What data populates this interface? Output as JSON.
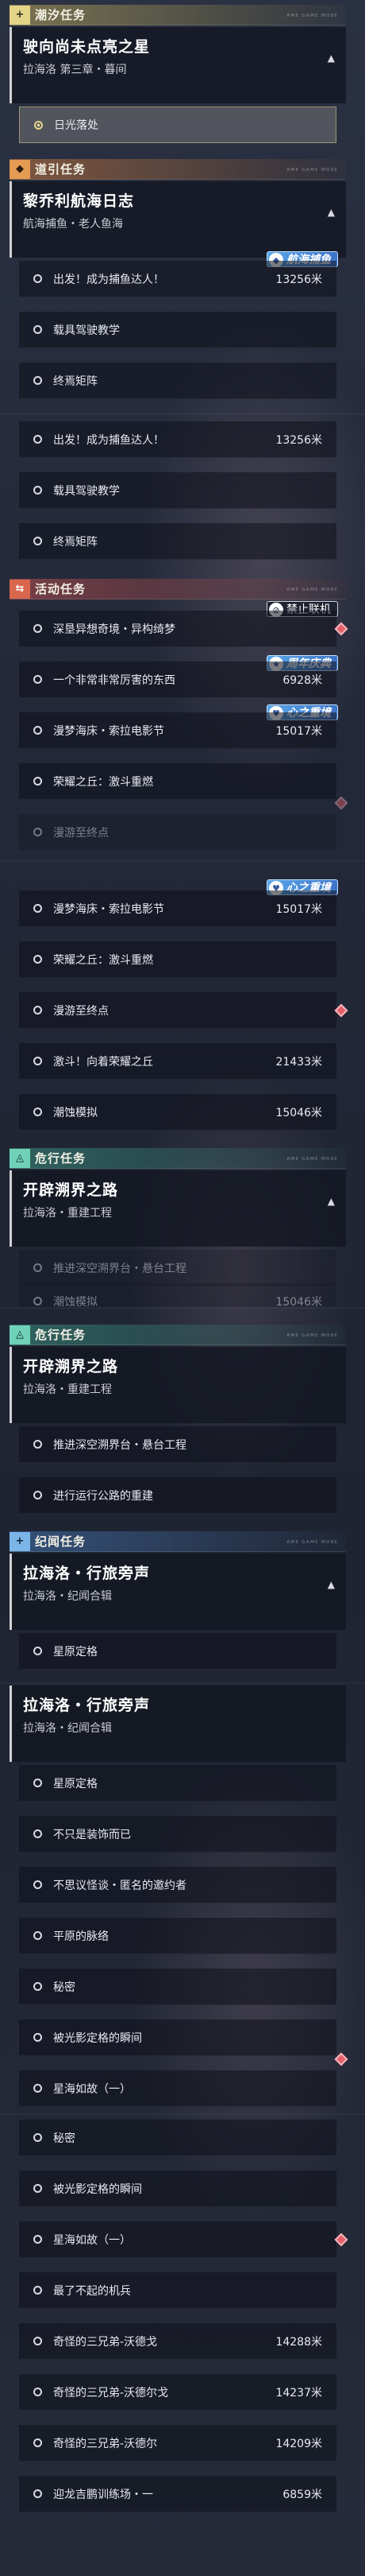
{
  "categories": {
    "tide": {
      "icon": "+",
      "title": "潮汐任务"
    },
    "guide": {
      "icon": "◆",
      "title": "道引任务"
    },
    "event": {
      "icon": "⇆",
      "title": "活动任务"
    },
    "danger": {
      "icon": "◬",
      "title": "危行任务"
    },
    "record": {
      "icon": "+",
      "title": "纪闻任务"
    },
    "deco": "ᴀᴍᴇ ɢᴀᴍᴇ ᴍᴏᴅᴇ"
  },
  "tide_card": {
    "title": "驶向尚未点亮之星",
    "sub": "拉海洛 第三章・暮间",
    "toggle": "▲"
  },
  "tide_item": "日光落处",
  "guide_card": {
    "title": "黎乔利航海日志",
    "sub": "航海捕鱼・老人鱼海",
    "toggle": "▲"
  },
  "guide_items": [
    {
      "label": "出发！成为捕鱼达人！",
      "dist": "13256米"
    },
    {
      "label": "载具驾驶教学",
      "dist": ""
    },
    {
      "label": "终焉矩阵",
      "dist": ""
    }
  ],
  "tags": {
    "fishing": "航海捕鱼",
    "nonet": "禁止联机",
    "anniv": "周年庆典",
    "heart": "心之重境"
  },
  "event_items": [
    {
      "label": "深垦异想奇境・异构绮梦",
      "dist": ""
    },
    {
      "label": "一个非常非常厉害的东西",
      "dist": "6928米"
    },
    {
      "label": "漫梦海床・索拉电影节",
      "dist": "15017米"
    },
    {
      "label": "荣耀之丘：激斗重燃",
      "dist": ""
    },
    {
      "label": "漫游至终点",
      "dist": ""
    },
    {
      "label": "激斗！向着荣耀之丘",
      "dist": "21433米"
    },
    {
      "label": "潮蚀模拟",
      "dist": "15046米"
    }
  ],
  "danger_card": {
    "title": "开辟溯界之路",
    "sub": "拉海洛・重建工程",
    "toggle": "▲"
  },
  "danger_items": [
    {
      "label": "推进深空溯界台・悬台工程",
      "dist": ""
    },
    {
      "label": "进行运行公路的重建",
      "dist": ""
    }
  ],
  "record_card": {
    "title": "拉海洛・行旅旁声",
    "sub": "拉海洛・纪闻合辑",
    "toggle": "▲"
  },
  "record_items": [
    {
      "label": "星原定格",
      "dist": ""
    },
    {
      "label": "不只是装饰而已",
      "dist": ""
    },
    {
      "label": "不思议怪谈・匿名的邀约者",
      "dist": ""
    },
    {
      "label": "平原的脉络",
      "dist": ""
    },
    {
      "label": "秘密",
      "dist": ""
    },
    {
      "label": "被光影定格的瞬间",
      "dist": ""
    },
    {
      "label": "星海如故（一）",
      "dist": ""
    },
    {
      "label": "最了不起的机兵",
      "dist": ""
    },
    {
      "label": "奇怪的三兄弟-沃德戈",
      "dist": "14288米"
    },
    {
      "label": "奇怪的三兄弟-沃德尔戈",
      "dist": "14237米"
    },
    {
      "label": "奇怪的三兄弟-沃德尔",
      "dist": "14209米"
    },
    {
      "label": "迎龙吉鹏训练场・一",
      "dist": "6859米"
    }
  ],
  "colors": {
    "accent_yellow": "#e4d487",
    "accent_orange": "#e59a52",
    "accent_red": "#d9674d",
    "accent_green": "#6fd2b8",
    "accent_blue": "#7cb5e8",
    "marker": "#e4606a"
  }
}
